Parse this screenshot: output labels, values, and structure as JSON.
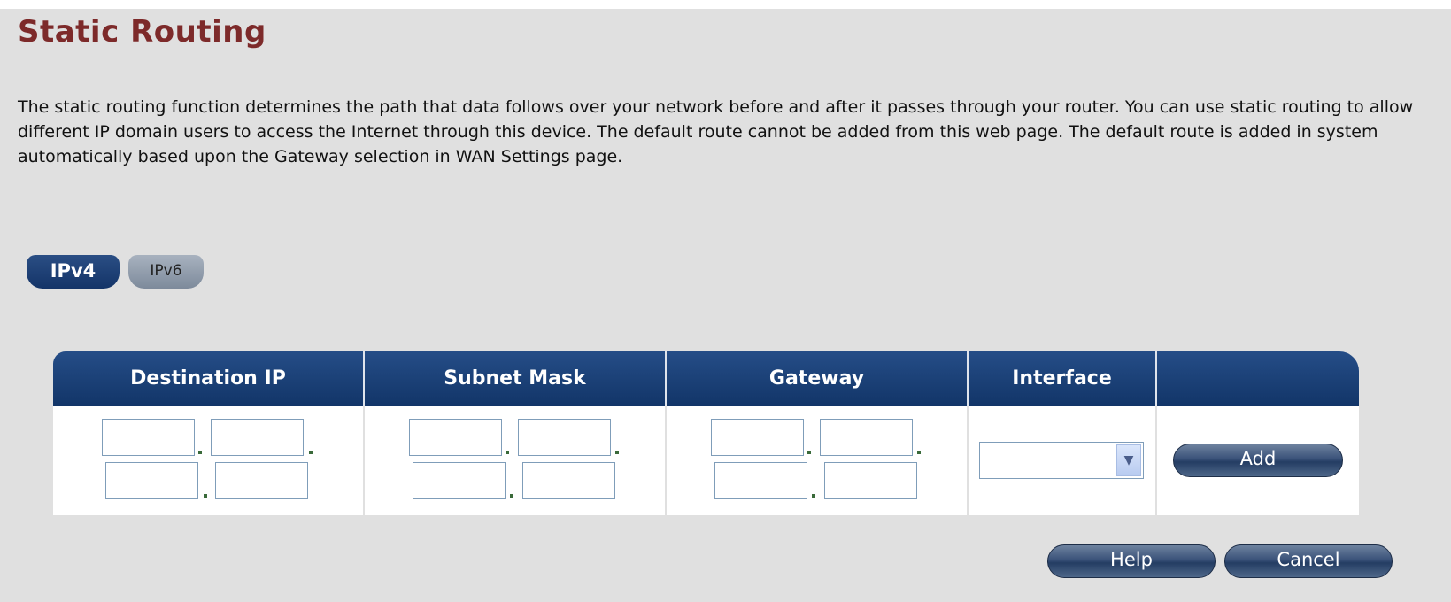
{
  "page": {
    "title": "Static Routing",
    "description": "The static routing function determines the path that data follows over your network before and after it passes through your router. You can use static routing to allow different IP domain users to access the Internet through this device. The default route cannot be added from this web page. The default route is added in system automatically based upon the Gateway selection in WAN Settings page."
  },
  "tabs": [
    {
      "label": "IPv4",
      "active": true
    },
    {
      "label": "IPv6",
      "active": false
    }
  ],
  "table": {
    "headers": [
      "Destination IP",
      "Subnet Mask",
      "Gateway",
      "Interface",
      ""
    ],
    "row": {
      "destination_ip": [
        "",
        "",
        "",
        ""
      ],
      "subnet_mask": [
        "",
        "",
        "",
        ""
      ],
      "gateway": [
        "",
        "",
        "",
        ""
      ],
      "interface_selected": "",
      "add_label": "Add"
    }
  },
  "buttons": {
    "help": "Help",
    "cancel": "Cancel"
  },
  "colors": {
    "title": "#7d2a2a",
    "header_bg": "#143468",
    "panel_bg": "#e0e0e0"
  }
}
